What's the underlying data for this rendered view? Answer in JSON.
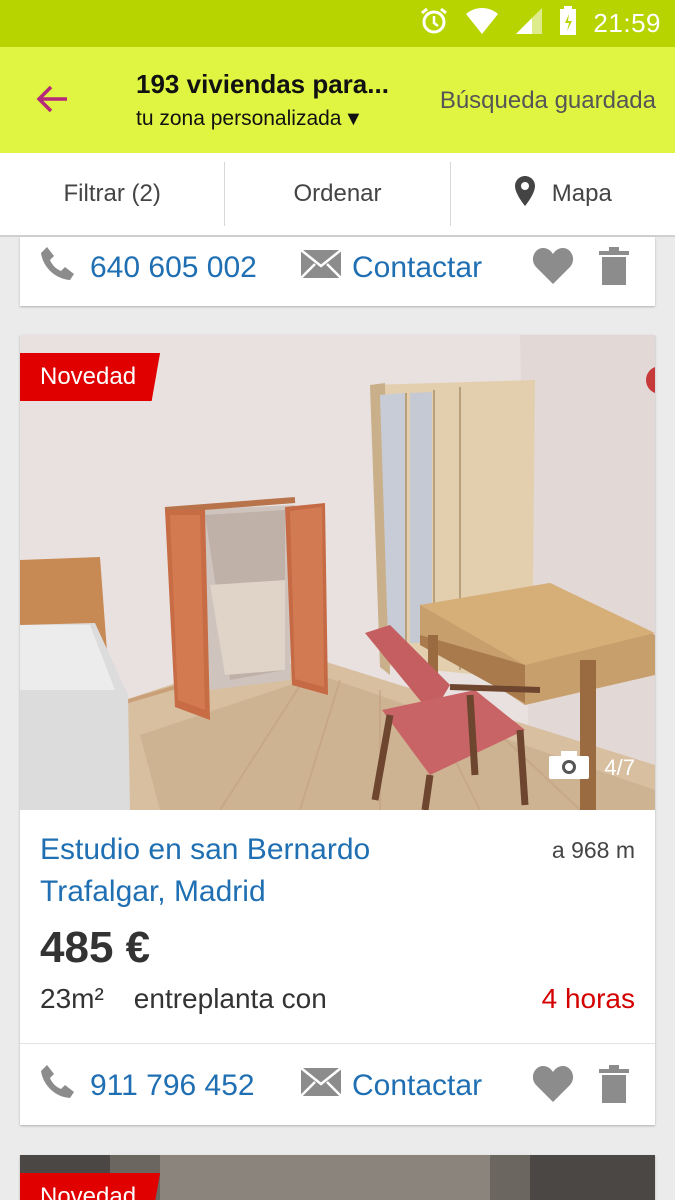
{
  "status_bar": {
    "time": "21:59",
    "icons": [
      "alarm-icon",
      "wifi-icon",
      "signal-icon",
      "battery-icon"
    ],
    "color": "#b7d400"
  },
  "header": {
    "title": "193 viviendas para...",
    "subtitle": "tu zona personalizada",
    "dropdown_arrow": "▼",
    "saved_search": "Búsqueda guardada",
    "color": "#dff542",
    "back_icon": "back-arrow-icon"
  },
  "toolbar": {
    "filter": "Filtrar (2)",
    "sort": "Ordenar",
    "map": "Mapa"
  },
  "listings": [
    {
      "phone": "640 605 002",
      "contact_label": "Contactar"
    },
    {
      "badge": "Novedad",
      "photo_counter": "4/7",
      "title": "Estudio en san Bernardo Trafalgar, Madrid",
      "distance": "a 968 m",
      "price": "485 €",
      "size": "23m²",
      "description": "entreplanta con",
      "time_ago": "4 horas",
      "phone": "911 796 452",
      "contact_label": "Contactar"
    },
    {
      "badge": "Novedad"
    }
  ],
  "colors": {
    "link_blue": "#1f6fb2",
    "badge_red": "#e00000",
    "time_red": "#d40000",
    "icon_gray": "#8c8c8c"
  }
}
